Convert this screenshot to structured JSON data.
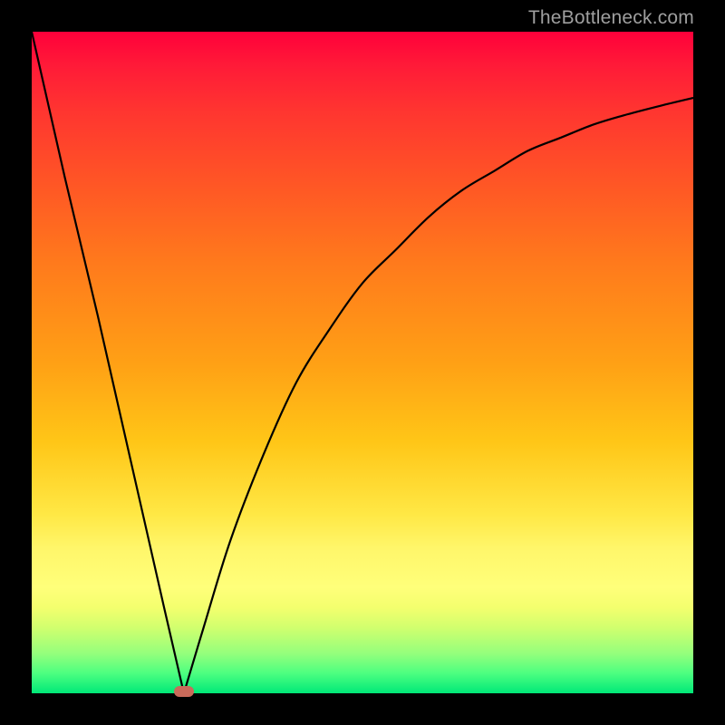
{
  "credit_text": "TheBottleneck.com",
  "colors": {
    "frame": "#000000",
    "credit": "#9f9f9f",
    "curve": "#000000",
    "marker": "#c96a5a",
    "gradient_top": "#ff003a",
    "gradient_bottom": "#00e878"
  },
  "chart_data": {
    "type": "line",
    "title": "",
    "xlabel": "",
    "ylabel": "",
    "xlim": [
      0,
      100
    ],
    "ylim": [
      0,
      100
    ],
    "grid": false,
    "legend": false,
    "annotations": [],
    "series": [
      {
        "name": "left-branch",
        "x": [
          0,
          5,
          10,
          15,
          20,
          23
        ],
        "values": [
          100,
          78,
          57,
          35,
          13,
          0
        ]
      },
      {
        "name": "right-branch",
        "x": [
          23,
          26,
          30,
          35,
          40,
          45,
          50,
          55,
          60,
          65,
          70,
          75,
          80,
          85,
          90,
          95,
          100
        ],
        "values": [
          0,
          10,
          23,
          36,
          47,
          55,
          62,
          67,
          72,
          76,
          79,
          82,
          84,
          86,
          87.5,
          88.8,
          90
        ]
      }
    ],
    "marker": {
      "x": 23,
      "y": 0
    }
  }
}
